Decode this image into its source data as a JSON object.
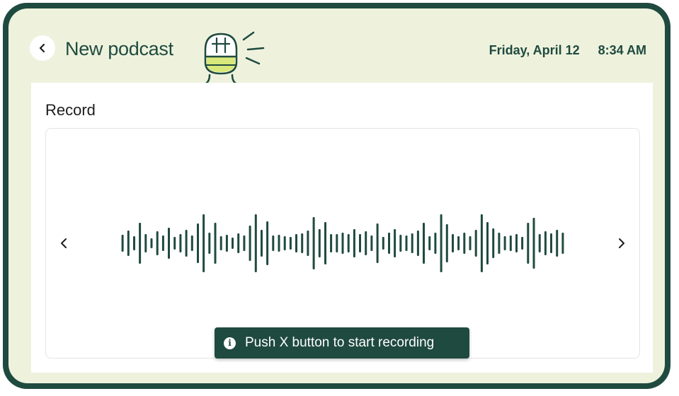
{
  "header": {
    "title": "New podcast",
    "date": "Friday, April 12",
    "time": "8:34 AM",
    "back_icon": "chevron-left-icon",
    "mascot_icon": "microphone-mascot-icon"
  },
  "record": {
    "section_title": "Record",
    "prev_icon": "chevron-left-icon",
    "next_icon": "chevron-right-icon",
    "toast_text": "Push X button to start recording",
    "toast_icon": "info-icon"
  },
  "colors": {
    "primary": "#1f4a3f",
    "screen_bg": "#eef2dd",
    "accent": "#d9e87a"
  }
}
